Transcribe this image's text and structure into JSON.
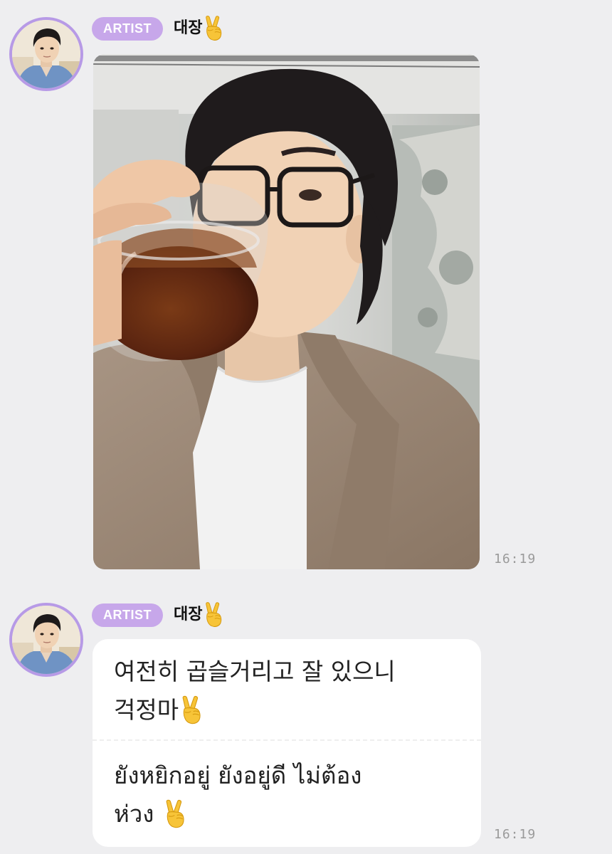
{
  "messages": [
    {
      "badge": "ARTIST",
      "sender": "대장",
      "content_type": "photo",
      "time": "16:19"
    },
    {
      "badge": "ARTIST",
      "sender": "대장",
      "content_type": "text",
      "korean_line1": "여전히 곱슬거리고 잘 있으니",
      "korean_line2": "걱정마",
      "thai_line1": "ยังหยิกอยู่ ยังอยู่ดี ไม่ต้อง",
      "thai_line2": "ห่วง",
      "time": "16:19"
    }
  ],
  "icons": {
    "sender_emoji": "victory-hand-icon",
    "text_emoji": "victory-hand-icon"
  },
  "colors": {
    "background": "#eeeef0",
    "badge": "#c7a7ea",
    "avatar_ring": "#b79ae6",
    "bubble": "#ffffff",
    "timestamp": "#9a9a9a"
  }
}
